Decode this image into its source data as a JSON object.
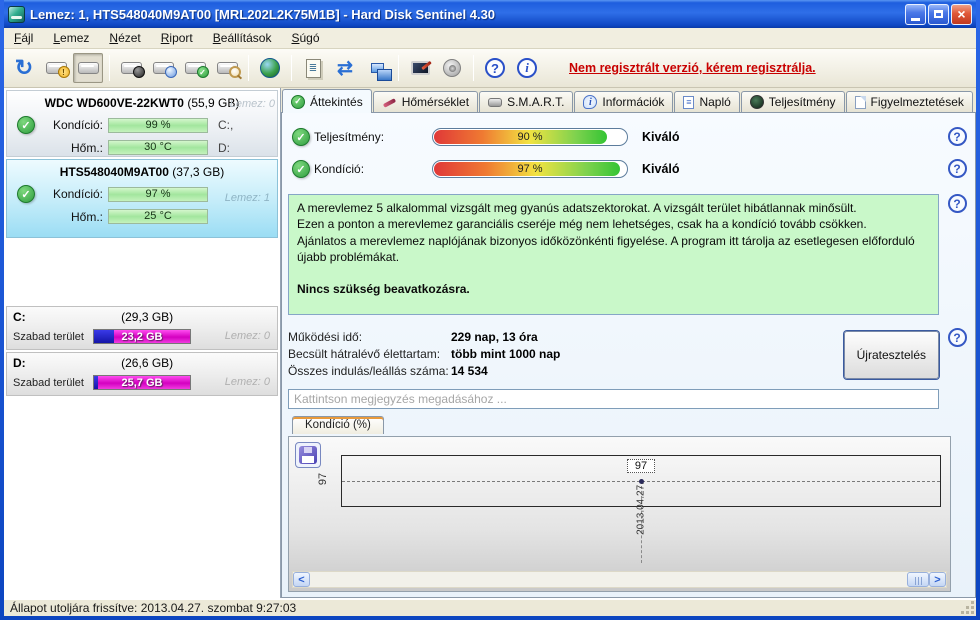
{
  "window": {
    "title": "Lemez: 1, HTS548040M9AT00 [MRL202L2K75M1B]  -  Hard Disk Sentinel 4.30"
  },
  "menu": {
    "items": [
      "Fájl",
      "Lemez",
      "Nézet",
      "Riport",
      "Beállítások",
      "Súgó"
    ]
  },
  "toolbar": {
    "register_link": "Nem regisztrált verzió, kérem regisztrálja.",
    "icons": [
      "refresh",
      "disk-alert",
      "disk-overview",
      "disk-performance",
      "disk-schedule",
      "disk-health",
      "disk-analyze",
      "web-disk",
      "report",
      "sync",
      "network",
      "remote-desktop",
      "sound",
      "help",
      "info"
    ]
  },
  "sidebar": {
    "disks": [
      {
        "name": "WDC WD600VE-22KWT0",
        "size": "(55,9 GB)",
        "ghost": "Lemez: 0",
        "rows": [
          {
            "label": "Kondíció:",
            "value": "99 %",
            "right": "C:,"
          },
          {
            "label": "Hőm.:",
            "value": "30 °C",
            "right": "D:"
          }
        ]
      },
      {
        "name": "HTS548040M9AT00",
        "size": "(37,3 GB)",
        "ghost": "Lemez: 1",
        "rows": [
          {
            "label": "Kondíció:",
            "value": "97 %",
            "right": ""
          },
          {
            "label": "Hőm.:",
            "value": "25 °C",
            "right": ""
          }
        ]
      }
    ],
    "partitions": [
      {
        "letter": "C:",
        "size": "(29,3 GB)",
        "free_label": "Szabad terület",
        "free_value": "23,2 GB",
        "used_pct": 21,
        "ghost": "Lemez: 0"
      },
      {
        "letter": "D:",
        "size": "(26,6 GB)",
        "free_label": "Szabad terület",
        "free_value": "25,7 GB",
        "used_pct": 4,
        "ghost": "Lemez: 0"
      }
    ]
  },
  "tabs": [
    {
      "label": "Áttekintés",
      "icon": "check-icon"
    },
    {
      "label": "Hőmérséklet",
      "icon": "thermometer-icon"
    },
    {
      "label": "S.M.A.R.T.",
      "icon": "disk-icon"
    },
    {
      "label": "Információk",
      "icon": "info-icon"
    },
    {
      "label": "Napló",
      "icon": "log-icon"
    },
    {
      "label": "Teljesítmény",
      "icon": "gauge-icon"
    },
    {
      "label": "Figyelmeztetések",
      "icon": "page-icon"
    }
  ],
  "overview": {
    "rows": [
      {
        "label": "Teljesítmény:",
        "value": "90 %",
        "pct": 90,
        "rating": "Kiváló"
      },
      {
        "label": "Kondíció:",
        "value": "97 %",
        "pct": 97,
        "rating": "Kiváló"
      }
    ],
    "message": {
      "line1": "A merevlemez 5 alkalommal vizsgált meg gyanús adatszektorokat. A vizsgált terület hibátlannak minősült.",
      "line2": "Ezen a ponton a merevlemez garanciális cseréje még nem lehetséges, csak ha a kondíció tovább csökken.",
      "line3": "Ajánlatos a merevlemez naplójának bizonyos időközönkénti figyelése. A program itt tárolja az esetlegesen előforduló újabb problémákat.",
      "emphasis": "Nincs szükség beavatkozásra."
    },
    "stats": [
      {
        "label": "Működési idő:",
        "value": "229 nap, 13 óra"
      },
      {
        "label": "Becsült hátralévő élettartam:",
        "value": "több mint 1000 nap"
      },
      {
        "label": "Összes indulás/leállás száma:",
        "value": "14 534"
      }
    ],
    "retest_button": "Újratesztelés",
    "comment_placeholder": "Kattintson megjegyzés megadásához ..."
  },
  "chart": {
    "tab_label": "Kondíció  (%)",
    "y_tick": "97",
    "point_label": "97",
    "x_tick": "2013.04.27."
  },
  "chart_data": {
    "type": "line",
    "title": "Kondíció (%)",
    "xlabel": "",
    "ylabel": "Kondíció (%)",
    "x": [
      "2013.04.27."
    ],
    "series": [
      {
        "name": "Kondíció (%)",
        "values": [
          97
        ]
      }
    ],
    "y_ticks": [
      97
    ],
    "grid": "dashed",
    "legend_position": "none"
  },
  "statusbar": {
    "text": "Állapot utoljára frissítve: 2013.04.27. szombat 9:27:03"
  },
  "colors": {
    "titlebar_blue": "#1e5ede",
    "register_red": "#c80000",
    "healthy_green": "#2f9e3f",
    "message_green_bg": "#c9f8c9",
    "free_space_magenta": "#d400c0",
    "used_space_blue": "#1515a8",
    "selected_panel_cyan": "#c3ecf9"
  }
}
